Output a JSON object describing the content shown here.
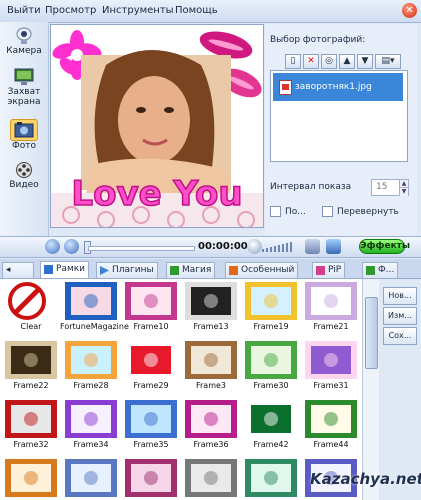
{
  "menu": {
    "items": [
      "Выйти",
      "Просмотр",
      "Инструменты",
      "Помощь"
    ],
    "close_icon": "close-icon"
  },
  "left_toolbar": {
    "items": [
      {
        "label": "Камера",
        "icon": "camera-icon"
      },
      {
        "label": "Захват экрана",
        "icon": "screen-capture-icon"
      },
      {
        "label": "Фото",
        "icon": "photo-icon"
      },
      {
        "label": "Видео",
        "icon": "video-icon"
      }
    ]
  },
  "preview": {
    "text": "Love You"
  },
  "photo_panel": {
    "title": "Выбор фотографий:",
    "toolbar_icons": [
      "page-icon",
      "delete-icon",
      "refresh-icon",
      "move-up-icon",
      "move-down-icon",
      "open-menu-icon"
    ],
    "files": [
      {
        "name": "заворотняк1.jpg",
        "selected": true
      }
    ],
    "interval_label": "Интервал показа",
    "interval_value": "15",
    "check_1_label": "По...",
    "check_2_label": "Перевернуть"
  },
  "playback": {
    "time": "00:00:00",
    "progress_fraction": 0,
    "effects_label": "Эффекты"
  },
  "tabs": [
    {
      "label": "Рамки",
      "active": true,
      "icon": "frames-icon"
    },
    {
      "label": "Плагины",
      "active": false,
      "icon": "plugins-icon"
    },
    {
      "label": "Магия",
      "active": false,
      "icon": "magic-icon"
    },
    {
      "label": "Особенный",
      "active": false,
      "icon": "special-icon"
    },
    {
      "label": "PiP",
      "active": false,
      "icon": "pip-icon"
    },
    {
      "label": "Ф...",
      "active": false,
      "icon": "effects-tab-icon"
    }
  ],
  "gallery": {
    "items": [
      "Clear",
      "FortuneMagazine",
      "Frame10",
      "Frame13",
      "Frame19",
      "Frame21",
      "Frame22",
      "Frame28",
      "Frame29",
      "Frame3",
      "Frame30",
      "Frame31",
      "Frame32",
      "Frame34",
      "Frame35",
      "Frame36",
      "Frame42",
      "Frame44",
      "",
      "",
      "",
      "",
      "",
      ""
    ]
  },
  "side_buttons": [
    "Нов...",
    "Изм...",
    "Сох..."
  ],
  "watermark": "Kazachya.net",
  "colors": {
    "selection": "#3a87d9",
    "accent_pink": "#ff4fc8",
    "effects_green": "#21b021"
  }
}
